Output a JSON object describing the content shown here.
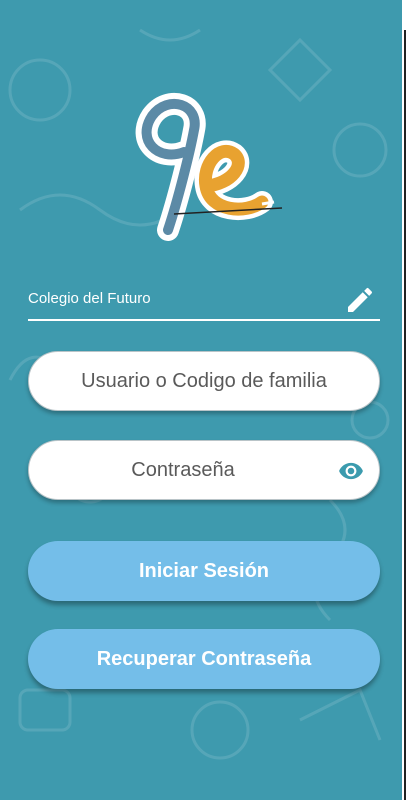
{
  "school": {
    "name": "Colegio del Futuro",
    "edit_icon": "pencil-icon"
  },
  "login_form": {
    "username_placeholder": "Usuario o Codigo de familia",
    "password_placeholder": "Contraseña",
    "password_toggle_icon": "eye-icon",
    "login_button": "Iniciar Sesión",
    "recover_button": "Recuperar Contraseña"
  },
  "colors": {
    "background": "#3e9aae",
    "button": "#74bee9",
    "logo_blue": "#5c8aa6",
    "logo_orange": "#e8a230",
    "eye_icon": "#3b9bae"
  }
}
